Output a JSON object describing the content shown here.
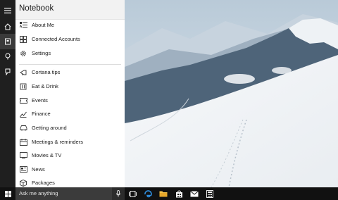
{
  "panel": {
    "title": "Notebook",
    "top_items": [
      {
        "label": "About Me",
        "icon": "about-me-icon"
      },
      {
        "label": "Connected Accounts",
        "icon": "connected-accounts-icon"
      },
      {
        "label": "Settings",
        "icon": "settings-gear-icon"
      }
    ],
    "items": [
      {
        "label": "Cortana tips",
        "icon": "tips-icon"
      },
      {
        "label": "Eat & Drink",
        "icon": "eat-drink-icon"
      },
      {
        "label": "Events",
        "icon": "events-ticket-icon"
      },
      {
        "label": "Finance",
        "icon": "finance-chart-icon"
      },
      {
        "label": "Getting around",
        "icon": "car-icon"
      },
      {
        "label": "Meetings & reminders",
        "icon": "meetings-icon"
      },
      {
        "label": "Movies & TV",
        "icon": "movies-tv-icon"
      },
      {
        "label": "News",
        "icon": "news-icon"
      },
      {
        "label": "Packages",
        "icon": "package-icon"
      }
    ]
  },
  "rail": {
    "items": [
      "hamburger-menu-icon",
      "home-icon",
      "notebook-icon",
      "lightbulb-icon",
      "feedback-icon"
    ]
  },
  "taskbar": {
    "search_placeholder": "Ask me anything",
    "apps": [
      "task-view-icon",
      "edge-icon",
      "file-explorer-icon",
      "store-icon",
      "mail-icon",
      "calculator-icon"
    ]
  }
}
